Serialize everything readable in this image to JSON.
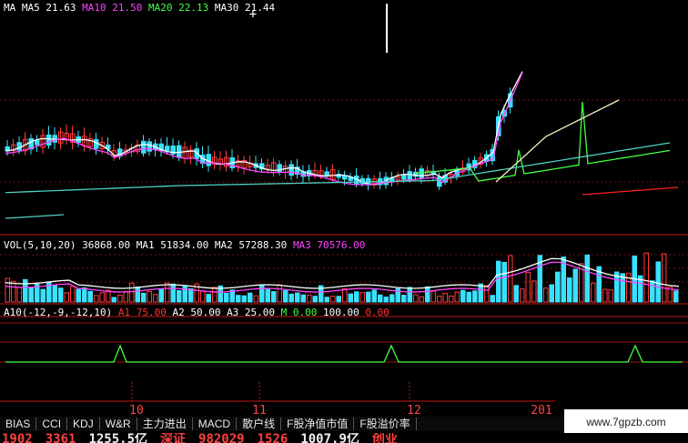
{
  "price_panel": {
    "legend": [
      {
        "label": "MA",
        "value": "",
        "color": "#ffffff"
      },
      {
        "label": "MA5",
        "value": "21.63",
        "color": "#ffffff"
      },
      {
        "label": "MA10",
        "value": "21.50",
        "color": "#ff44ff"
      },
      {
        "label": "MA20",
        "value": "22.13",
        "color": "#44ff44"
      },
      {
        "label": "MA30",
        "value": "21.44",
        "color": "#ffffff"
      }
    ]
  },
  "volume_panel": {
    "legend": [
      {
        "label": "VOL(5,10,20)",
        "value": "36868.00",
        "color": "#ffffff"
      },
      {
        "label": "MA1",
        "value": "51834.00",
        "color": "#ffffff"
      },
      {
        "label": "MA2",
        "value": "57288.30",
        "color": "#ffffff"
      },
      {
        "label": "MA3",
        "value": "70576.00",
        "color": "#ff44ff"
      }
    ]
  },
  "indicator_panel": {
    "legend": [
      {
        "label": "A10(-12,-9,-12,10)",
        "value": "",
        "color": "#ffffff"
      },
      {
        "label": "A1",
        "value": "75.00",
        "color": "#ff3333"
      },
      {
        "label": "A2",
        "value": "50.00",
        "color": "#ffffff"
      },
      {
        "label": "A3",
        "value": "25.00",
        "color": "#ffffff"
      },
      {
        "label": "M",
        "value": "0.00",
        "color": "#44ff44"
      },
      {
        "label": "",
        "value": "100.00",
        "color": "#ffffff"
      },
      {
        "label": "",
        "value": "0.00",
        "color": "#ff3333"
      }
    ]
  },
  "time_axis": {
    "labels": [
      "10",
      "11",
      "12",
      "201"
    ]
  },
  "tabs": [
    "BIAS",
    "CCI",
    "KDJ",
    "W&R",
    "主力进出",
    "MACD",
    "散户线",
    "F股净值市值",
    "F股溢价率"
  ],
  "watermark": "www.7gpzb.com",
  "ticker": [
    {
      "text": "1902",
      "color": "red"
    },
    {
      "text": "3361",
      "color": "red"
    },
    {
      "text": "1255.5亿",
      "color": "white"
    },
    {
      "text": "深证",
      "color": "red"
    },
    {
      "text": "982029",
      "color": "red"
    },
    {
      "text": "1526",
      "color": "red"
    },
    {
      "text": "1007.9亿",
      "color": "white"
    },
    {
      "text": "创业",
      "color": "red"
    }
  ],
  "colors": {
    "up": "#ff3b3b",
    "down": "#39e1ff",
    "ma5": "#ffffff",
    "ma10": "#ff44ff",
    "ma20": "#44ff44",
    "ma30": "#e0e0e0",
    "grid": "#7a1010"
  }
}
